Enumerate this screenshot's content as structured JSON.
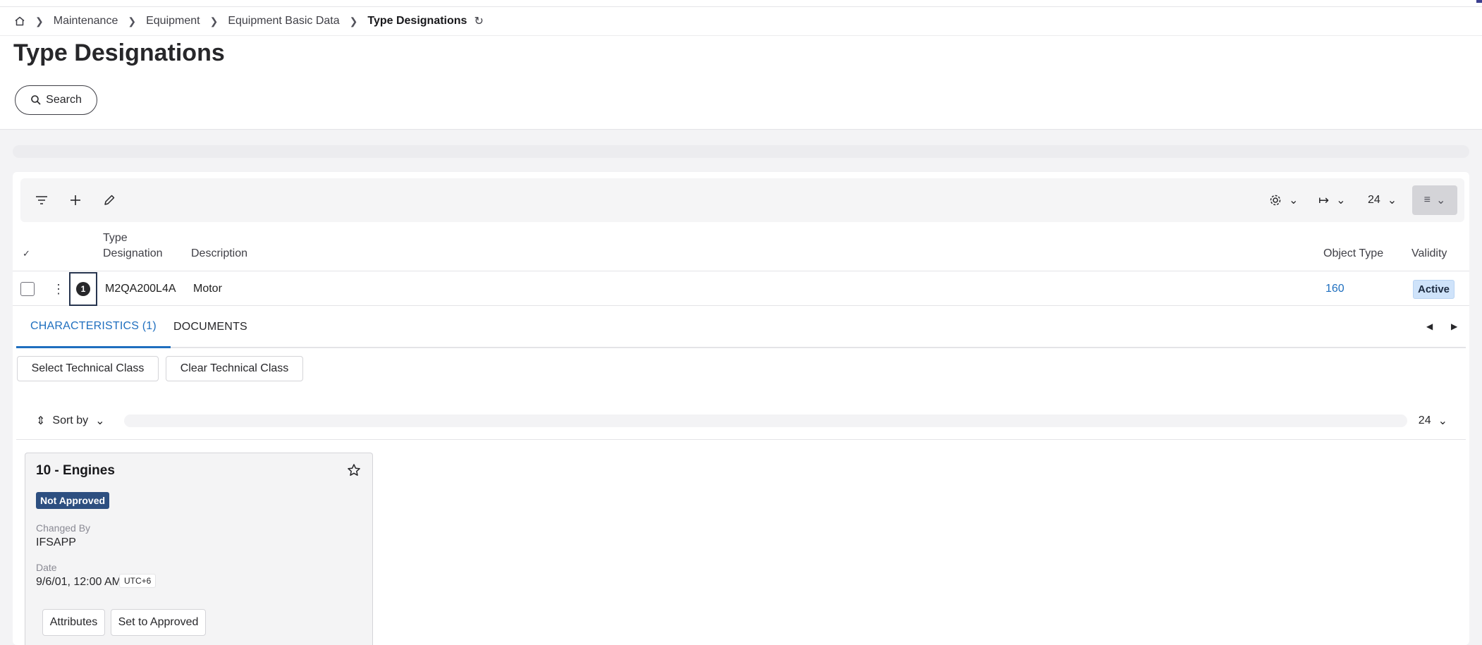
{
  "breadcrumb": {
    "items": [
      "Maintenance",
      "Equipment",
      "Equipment Basic Data"
    ],
    "current": "Type Designations"
  },
  "page": {
    "title": "Type Designations",
    "search_label": "Search"
  },
  "toolbar": {
    "page_size": "24"
  },
  "grid": {
    "headers": {
      "type_designation_line1": "Type",
      "type_designation_line2": "Designation",
      "description": "Description",
      "object_type": "Object Type",
      "validity": "Validity"
    },
    "rows": [
      {
        "row_number": "1",
        "type_designation": "M2QA200L4A",
        "description": "Motor",
        "object_type": "160",
        "validity": "Active"
      }
    ]
  },
  "tabs": {
    "characteristics": "CHARACTERISTICS (1)",
    "documents": "DOCUMENTS"
  },
  "actions": {
    "select_class": "Select Technical Class",
    "clear_class": "Clear Technical Class"
  },
  "sortbar": {
    "sort_label": "Sort by",
    "page_size": "24"
  },
  "card": {
    "title": "10 - Engines",
    "status": "Not Approved",
    "changed_by_label": "Changed By",
    "changed_by": "IFSAPP",
    "date_label": "Date",
    "date": "9/6/01, 12:00 AM",
    "timezone": "UTC+6",
    "attributes_label": "Attributes",
    "set_approved_label": "Set to Approved"
  },
  "colors": {
    "accent": "#1f6fbf",
    "status_not_approved": "#2d4f80",
    "status_active_bg": "#cfe3fa"
  }
}
